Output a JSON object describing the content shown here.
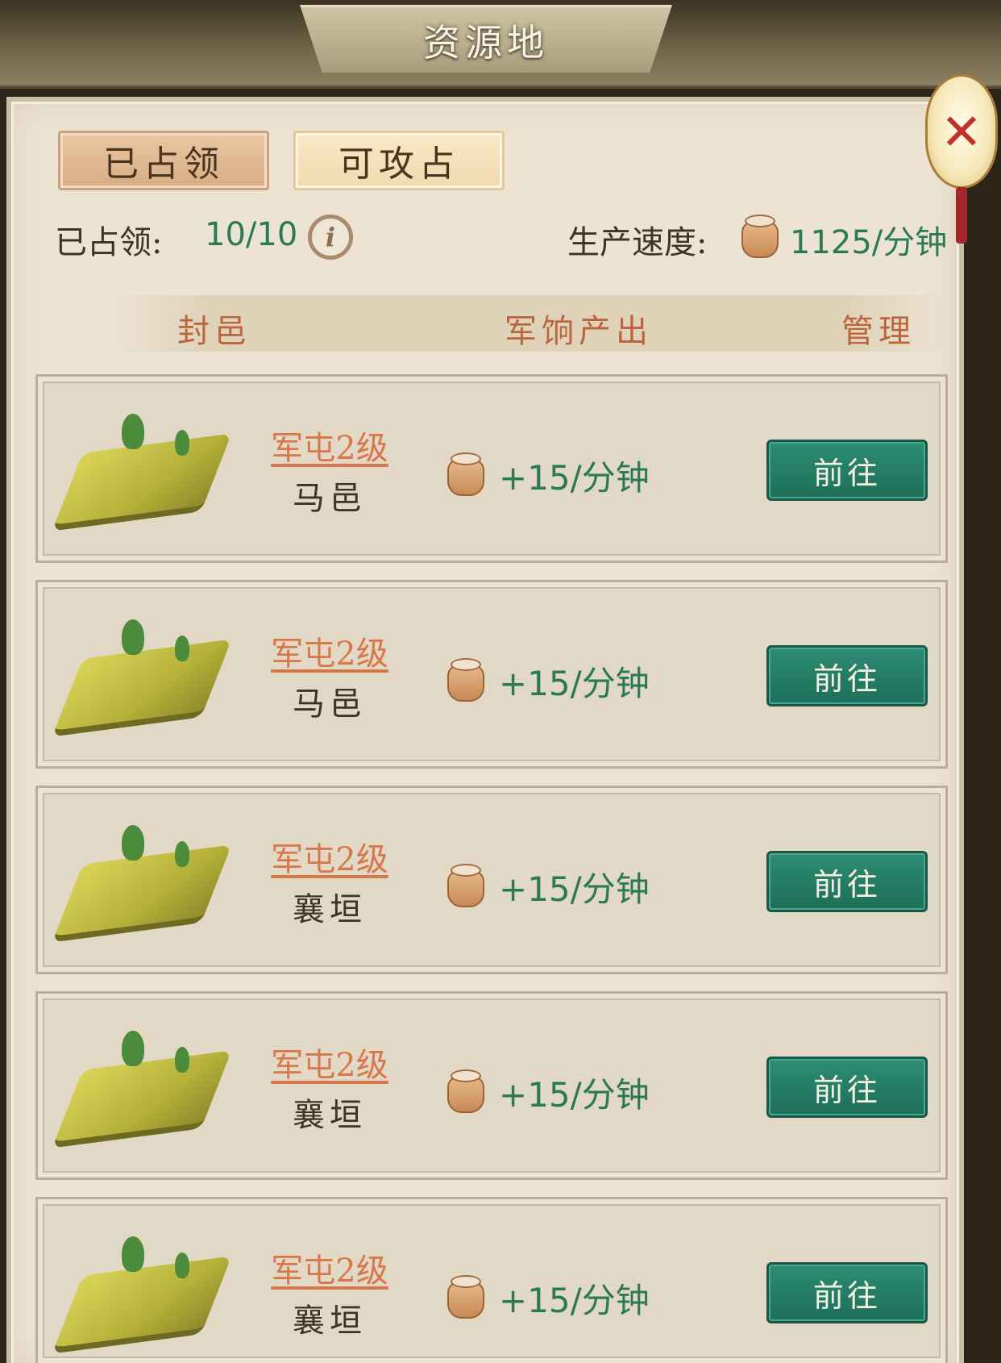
{
  "window": {
    "title": "资源地",
    "close_icon": "close-lantern-icon"
  },
  "tabs": [
    {
      "label": "已占领",
      "active": true
    },
    {
      "label": "可攻占",
      "active": false
    }
  ],
  "summary": {
    "occupied_label": "已占领:",
    "occupied_value": "10/10",
    "speed_label": "生产速度:",
    "speed_value": "1125/分钟"
  },
  "columns": {
    "fief": "封邑",
    "output": "军饷产出",
    "manage": "管理"
  },
  "rows": [
    {
      "level": "军屯2级",
      "place": "马邑",
      "output": "+15/分钟",
      "button": "前往"
    },
    {
      "level": "军屯2级",
      "place": "马邑",
      "output": "+15/分钟",
      "button": "前往"
    },
    {
      "level": "军屯2级",
      "place": "襄垣",
      "output": "+15/分钟",
      "button": "前往"
    },
    {
      "level": "军屯2级",
      "place": "襄垣",
      "output": "+15/分钟",
      "button": "前往"
    },
    {
      "level": "军屯2级",
      "place": "襄垣",
      "output": "+15/分钟",
      "button": "前往"
    }
  ],
  "colors": {
    "accent_green": "#2b7a54",
    "header_orange": "#b9653d",
    "button_teal": "#1d6f59"
  }
}
